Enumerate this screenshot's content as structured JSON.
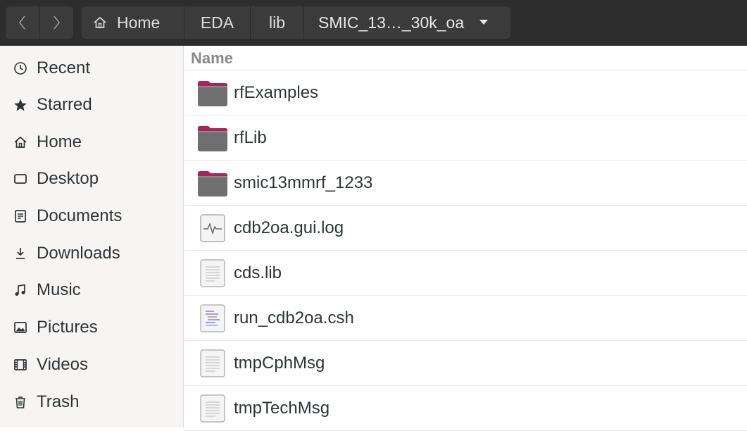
{
  "nav": {
    "back_icon": "chevron-left-icon",
    "forward_icon": "chevron-right-icon"
  },
  "pathbar": {
    "crumbs": [
      "Home",
      "EDA",
      "lib",
      "SMIC_13..._30k_oa"
    ],
    "current_display": "SMIC_13…_30k_oa"
  },
  "sidebar": {
    "items": [
      {
        "label": "Recent",
        "icon": "clock-icon"
      },
      {
        "label": "Starred",
        "icon": "star-icon"
      },
      {
        "label": "Home",
        "icon": "home-icon"
      },
      {
        "label": "Desktop",
        "icon": "desktop-icon"
      },
      {
        "label": "Documents",
        "icon": "documents-icon"
      },
      {
        "label": "Downloads",
        "icon": "download-icon"
      },
      {
        "label": "Music",
        "icon": "music-icon"
      },
      {
        "label": "Pictures",
        "icon": "picture-icon"
      },
      {
        "label": "Videos",
        "icon": "video-icon"
      },
      {
        "label": "Trash",
        "icon": "trash-icon"
      }
    ]
  },
  "list": {
    "column_name": "Name",
    "files": [
      {
        "name": "rfExamples",
        "type": "folder"
      },
      {
        "name": "rfLib",
        "type": "folder"
      },
      {
        "name": "smic13mmrf_1233",
        "type": "folder"
      },
      {
        "name": "cdb2oa.gui.log",
        "type": "log"
      },
      {
        "name": "cds.lib",
        "type": "text"
      },
      {
        "name": "run_cdb2oa.csh",
        "type": "script"
      },
      {
        "name": "tmpCphMsg",
        "type": "text"
      },
      {
        "name": "tmpTechMsg",
        "type": "text"
      }
    ]
  },
  "colors": {
    "header_bg": "#2d2d2d",
    "sidebar_bg": "#f6f5f4",
    "folder_tab": "#a8245a",
    "folder_body": "#6f6f6f"
  }
}
